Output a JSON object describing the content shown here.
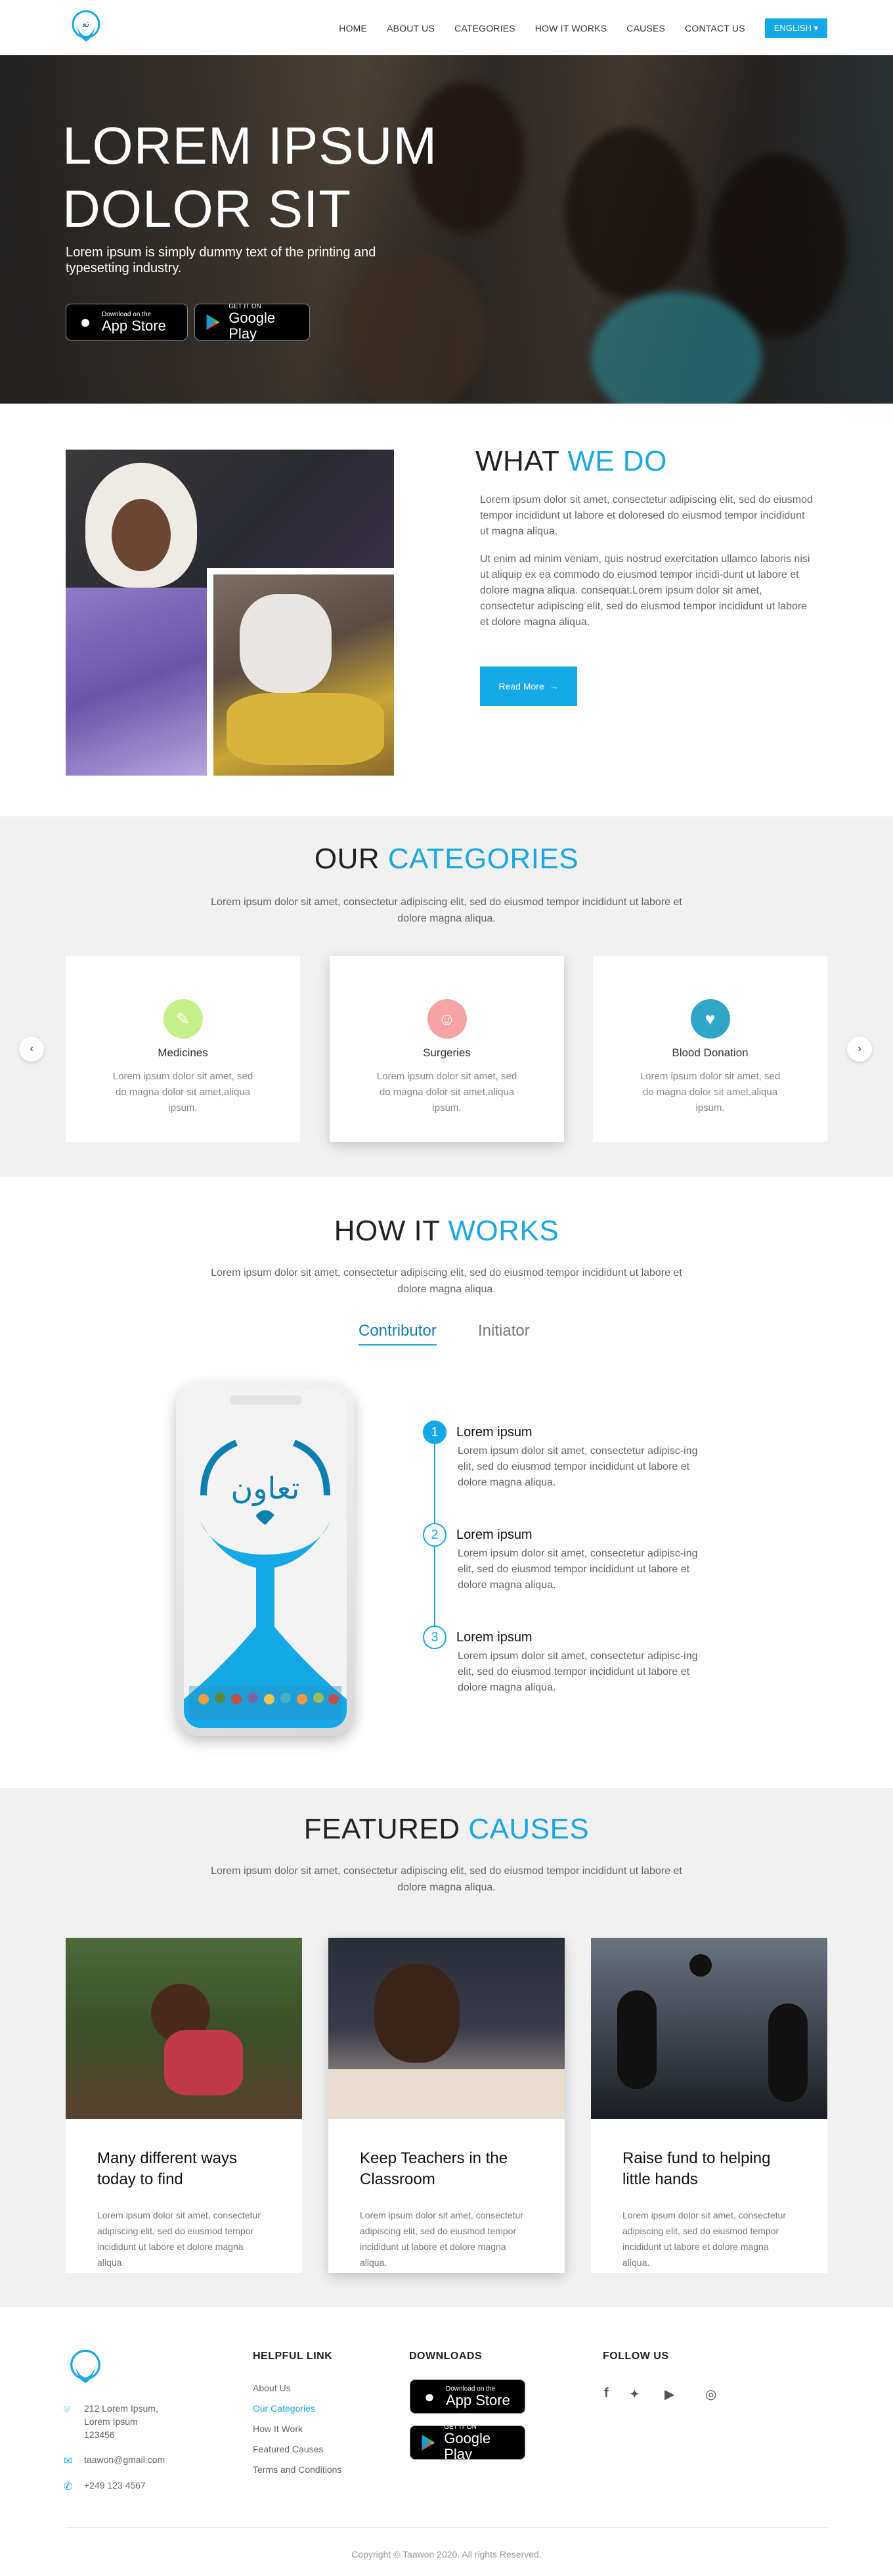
{
  "nav": {
    "items": [
      "HOME",
      "ABOUT US",
      "CATEGORIES",
      "HOW IT WORKS",
      "CAUSES",
      "CONTACT US"
    ],
    "language": "ENGLISH"
  },
  "hero": {
    "title": "LOREM IPSUM\nDOLOR SIT",
    "subtitle": "Lorem ipsum is simply dummy text of the printing and typesetting industry.",
    "app_store_small": "Download on the",
    "app_store_big": "App Store",
    "google_small": "GET IT ON",
    "google_big": "Google Play"
  },
  "what_we_do": {
    "title_a": "WHAT",
    "title_b": "WE DO",
    "p1": "Lorem ipsum dolor sit amet, consectetur adipiscing elit, sed do eiusmod tempor incididunt ut labore et doloresed do eiusmod tempor incididunt ut  magna aliqua.",
    "p2": "Ut enim ad minim veniam, quis nostrud exercitation ullamco laboris nisi ut aliquip ex ea commodo  do eiusmod tempor incidi-dunt ut labore et dolore magna aliqua.  consequat.Lorem ipsum dolor sit amet, consectetur adipiscing elit, sed do eiusmod tempor incididunt ut labore et dolore magna aliqua.",
    "read_more": "Read More"
  },
  "categories": {
    "title_a": "OUR",
    "title_b": "CATEGORIES",
    "subtitle": "Lorem ipsum dolor sit amet, consectetur adipiscing elit, sed do eiusmod tempor incididunt ut labore et dolore magna aliqua.",
    "cards": [
      {
        "name": "Medicines",
        "desc": "Lorem ipsum dolor sit amet,  sed do magna dolor sit amet,aliqua ipsum."
      },
      {
        "name": "Surgeries",
        "desc": "Lorem ipsum dolor sit amet,  sed do magna dolor sit amet,aliqua ipsum."
      },
      {
        "name": "Blood Donation",
        "desc": "Lorem ipsum dolor sit amet,  sed do magna dolor sit amet,aliqua ipsum."
      }
    ],
    "prev": "‹",
    "next": "›"
  },
  "how_it_works": {
    "title_a": "HOW IT",
    "title_b": "WORKS",
    "subtitle": "Lorem ipsum dolor sit amet, consectetur adipiscing elit, sed do eiusmod tempor incididunt ut labore et dolore magna aliqua.",
    "tab_active": "Contributor",
    "tab_inactive": "Initiator",
    "steps": [
      {
        "num": "1",
        "title": "Lorem ipsum",
        "desc": "Lorem ipsum dolor sit amet, consectetur adipisc-ing elit, sed do eiusmod tempor incididunt ut labore et dolore magna aliqua."
      },
      {
        "num": "2",
        "title": "Lorem ipsum",
        "desc": "Lorem ipsum dolor sit amet, consectetur adipisc-ing elit, sed do eiusmod tempor incididunt ut labore et dolore magna aliqua."
      },
      {
        "num": "3",
        "title": "Lorem ipsum",
        "desc": "Lorem ipsum dolor sit amet, consectetur adipisc-ing elit, sed do eiusmod tempor incididunt ut labore et dolore magna aliqua."
      }
    ]
  },
  "causes": {
    "title_a": "FEATURED",
    "title_b": "CAUSES",
    "subtitle": "Lorem ipsum dolor sit amet, consectetur adipiscing elit, sed do eiusmod tempor incididunt ut labore et dolore magna aliqua.",
    "cards": [
      {
        "title": "Many different ways today to find",
        "desc": "Lorem ipsum dolor sit amet, consectetur adipiscing elit, sed do eiusmod tempor incididunt ut labore et dolore magna aliqua."
      },
      {
        "title": "Keep Teachers in the Classroom",
        "desc": "Lorem ipsum dolor sit amet, consectetur adipiscing elit, sed do eiusmod tempor incididunt ut labore et dolore magna aliqua."
      },
      {
        "title": "Raise fund to helping little hands",
        "desc": "Lorem ipsum dolor sit amet, consectetur adipiscing elit, sed do eiusmod tempor incididunt ut labore et dolore magna aliqua."
      }
    ]
  },
  "footer": {
    "address": "212 Lorem Ipsum,\nLorem Ipsum\n123456",
    "email": "taawon@gmail.com",
    "phone": "+249 123 4567",
    "helpful_title": "HELPFUL LINK",
    "links": [
      "About Us",
      "Our Categories",
      "How It Work",
      "Featured Causes",
      "Terms and Conditions"
    ],
    "downloads_title": "DOWNLOADS",
    "follow_title": "FOLLOW US",
    "social": [
      "facebook-icon",
      "twitter-icon",
      "youtube-icon",
      "instagram-icon"
    ],
    "copyright": "Copyright © Taawon 2020. All rights Reserved."
  },
  "colors": {
    "accent": "#14a9e6",
    "section_gray": "#f1f1f1"
  }
}
